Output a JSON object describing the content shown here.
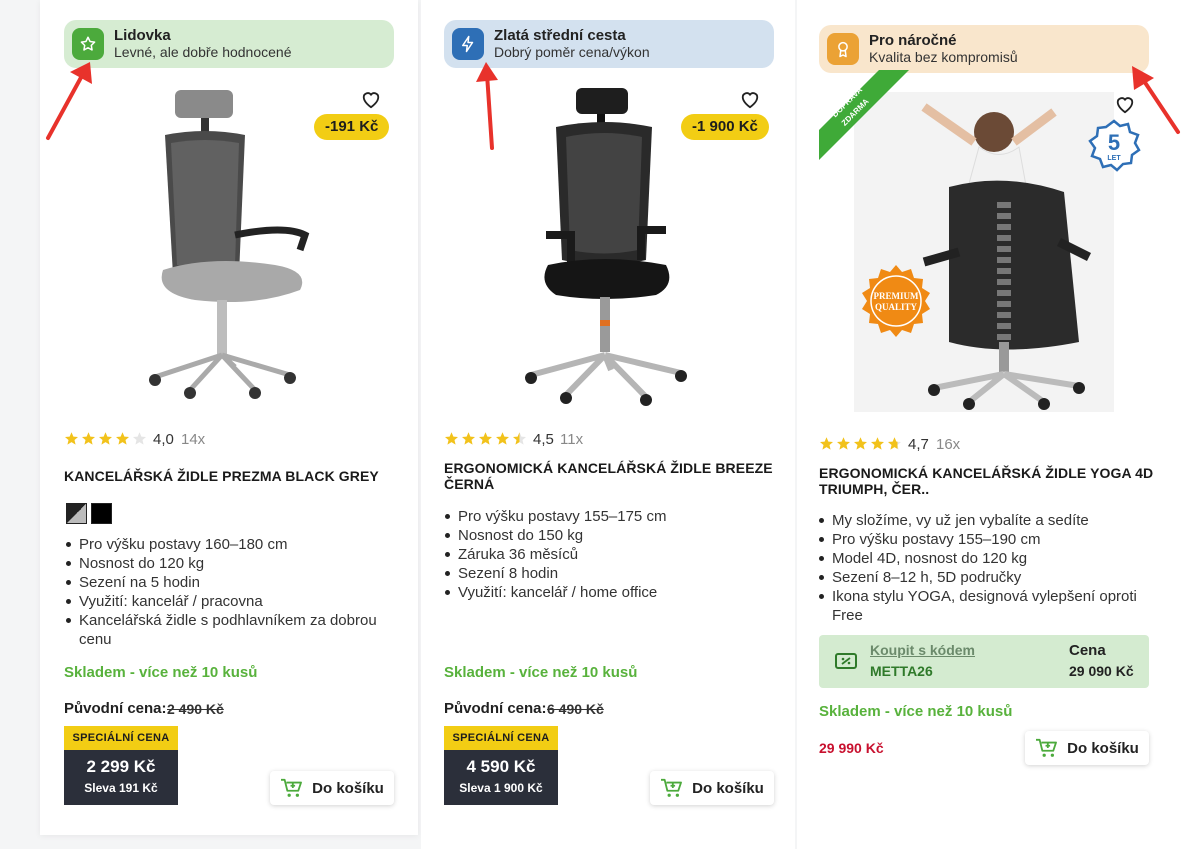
{
  "colors": {
    "accent_green": "#58b23c",
    "badge_yellow": "#f2cd14",
    "dark_box": "#2b2f3a",
    "red_price": "#c8102e",
    "arrow_red": "#e8322b"
  },
  "products": [
    {
      "banner": {
        "title": "Lidovka",
        "subtitle": "Levné, ale dobře hodnocené",
        "icon": "star-icon",
        "bg": "#d6ecd2",
        "icon_bg": "#4caa3c"
      },
      "discount": "-191 Kč",
      "rating": "4,0",
      "rating_value": 4.0,
      "reviews": "14x",
      "title": "Kancelářská židle PREZMA BLACK GREY",
      "features": [
        "Pro výšku postavy 160–180 cm",
        "Nosnost do 120 kg",
        "Sezení na 5 hodin",
        "Využití: kancelář / pracovna",
        "Kancelářská židle s podhlavníkem za dobrou cenu"
      ],
      "stock": "Skladem - více než 10 kusů",
      "original_label": "Původní cena:",
      "original_price": "2 490 Kč",
      "special_label": "SPECIÁLNÍ CENA",
      "special_price": "2 299 Kč",
      "savings": "Sleva 191 Kč",
      "cart": "Do košíku"
    },
    {
      "banner": {
        "title": "Zlatá střední cesta",
        "subtitle": "Dobrý poměr cena/výkon",
        "icon": "lightning-icon",
        "bg": "#d3e1ef",
        "icon_bg": "#2e6fb6"
      },
      "discount": "-1 900 Kč",
      "rating": "4,5",
      "rating_value": 4.5,
      "reviews": "11x",
      "title": "Ergonomická kancelářská židle BREEZE černá",
      "features": [
        "Pro výšku postavy 155–175 cm",
        "Nosnost do 150 kg",
        "Záruka 36 měsíců",
        "Sezení 8 hodin",
        "Využití: kancelář / home office"
      ],
      "stock": "Skladem - více než 10 kusů",
      "original_label": "Původní cena:",
      "original_price": "6 490 Kč",
      "special_label": "SPECIÁLNÍ CENA",
      "special_price": "4 590 Kč",
      "savings": "Sleva 1 900 Kč",
      "cart": "Do košíku"
    },
    {
      "banner": {
        "title": "Pro náročné",
        "subtitle": "Kvalita bez kompromisů",
        "icon": "award-icon",
        "bg": "#f9e6cc",
        "icon_bg": "#eba235"
      },
      "ribbon": [
        "DOPRAVA",
        "ZDARMA"
      ],
      "warranty": {
        "number": "5",
        "unit": "LET"
      },
      "quality_seal": [
        "PREMIUM",
        "QUALITY"
      ],
      "rating": "4,7",
      "rating_value": 4.7,
      "reviews": "16x",
      "title": "Ergonomická kancelářská židle YOGA 4D TRIUMPH, čer..",
      "features": [
        "My složíme, vy už jen vybalíte a sedíte",
        "Pro výšku postavy 155–190 cm",
        "Model 4D, nosnost do 120 kg",
        "Sezení 8–12 h, 5D područky",
        "Ikona stylu YOGA, designová vylepšení oproti Free"
      ],
      "coupon": {
        "link": "Koupit s kódem",
        "code": "METTA26",
        "label": "Cena",
        "price": "29 090 Kč"
      },
      "stock": "Skladem - více než 10 kusů",
      "price": "29 990 Kč",
      "cart": "Do košíku"
    }
  ]
}
